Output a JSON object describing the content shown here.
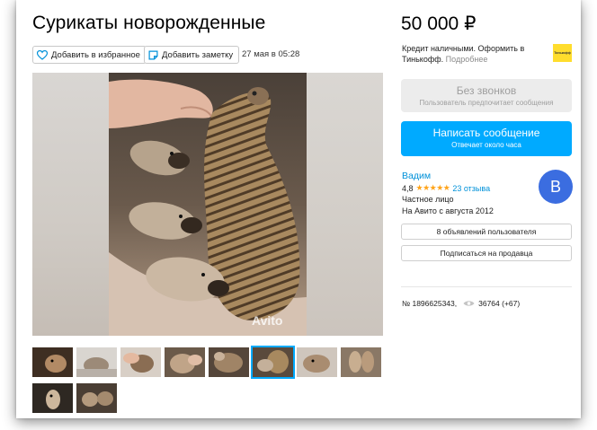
{
  "listing": {
    "title": "Сурикаты новорожденные",
    "price": "50 000 ₽",
    "date": "27 мая в 05:28",
    "id_text": "№ 1896625343,",
    "views": "36764 (+67)"
  },
  "actions": {
    "favorite_label": "Добавить в избранное",
    "note_label": "Добавить заметку"
  },
  "credit": {
    "text": "Кредит наличными. Оформить в Тинькофф.",
    "more": "Подробнее",
    "logo_text": "Тинькофф"
  },
  "photo": {
    "watermark": "Avito",
    "thumbnail_count": 11,
    "active_thumbnail": 5
  },
  "contact": {
    "no_calls_label": "Без звонков",
    "no_calls_sub": "Пользователь предпочитает сообщения",
    "message_label": "Написать сообщение",
    "message_sub": "Отвечает около часа"
  },
  "seller": {
    "name": "Вадим",
    "rating": "4,8",
    "stars": "★★★★★",
    "reviews": "23 отзыва",
    "type": "Частное лицо",
    "since": "На Авито с августа 2012",
    "avatar_letter": "В",
    "listings_button": "8 объявлений пользователя",
    "subscribe_button": "Подписаться на продавца"
  },
  "colors": {
    "accent": "#00aaff",
    "link": "#0091d9",
    "avatar": "#3b6de0",
    "star": "#ffa41b",
    "tinkoff": "#ffdd2d"
  }
}
